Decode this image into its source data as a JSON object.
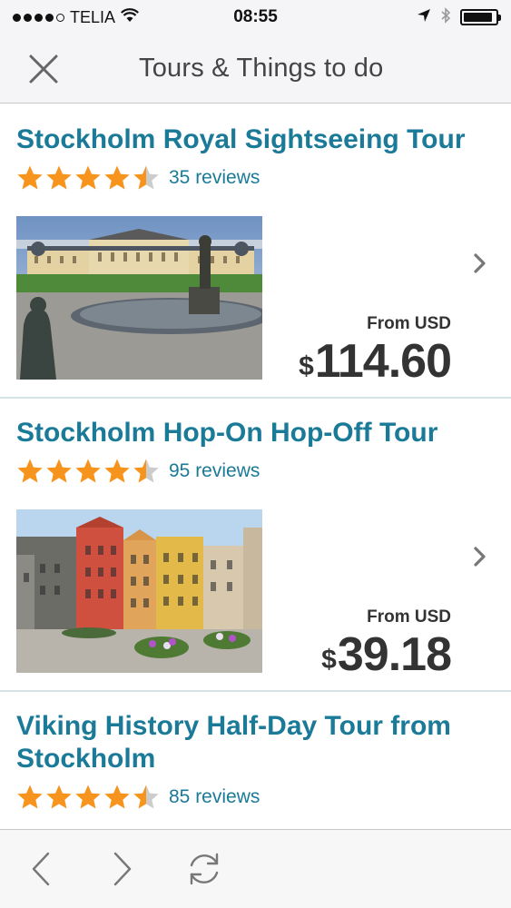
{
  "status_bar": {
    "carrier": "TELIA",
    "time": "08:55",
    "signal_bars_filled": 4,
    "signal_bars_total": 5,
    "battery_level": 0.9
  },
  "nav": {
    "title": "Tours & Things to do",
    "close_icon": "close-icon"
  },
  "colors": {
    "title_blue": "#1a7a98",
    "star_orange": "#f7941d",
    "star_empty": "#cccccc",
    "price_text": "#333333"
  },
  "tours": [
    {
      "title": "Stockholm Royal Sightseeing Tour",
      "rating": 4.5,
      "reviews": "35 reviews",
      "from_label": "From USD",
      "currency": "$",
      "price": "114.60",
      "image": "palace-photo"
    },
    {
      "title": "Stockholm Hop-On Hop-Off Tour",
      "rating": 4.5,
      "reviews": "95 reviews",
      "from_label": "From USD",
      "currency": "$",
      "price": "39.18",
      "image": "old-town-houses-photo"
    },
    {
      "title": "Viking History Half-Day Tour from Stockholm",
      "rating": 4.5,
      "reviews": "85 reviews"
    }
  ],
  "toolbar": {
    "back_icon": "back-arrow-icon",
    "forward_icon": "forward-arrow-icon",
    "refresh_icon": "refresh-icon"
  }
}
